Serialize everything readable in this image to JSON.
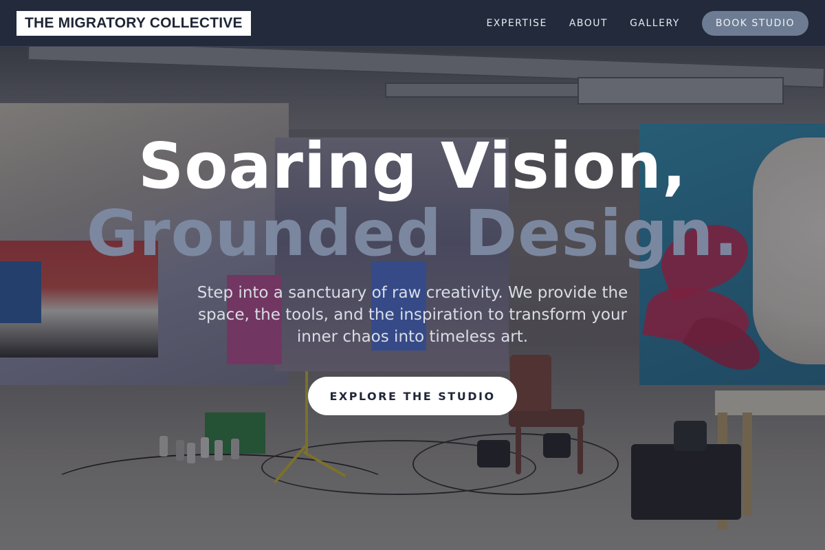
{
  "header": {
    "brand": "THE MIGRATORY COLLECTIVE",
    "nav": [
      {
        "label": "EXPERTISE"
      },
      {
        "label": "ABOUT"
      },
      {
        "label": "GALLERY"
      }
    ],
    "cta_label": "BOOK STUDIO"
  },
  "hero": {
    "headline_line1": "Soaring Vision,",
    "headline_line2": "Grounded Design.",
    "subtext": "Step into a sanctuary of raw creativity. We provide the space, the tools, and the inspiration to transform your inner chaos into timeless art.",
    "cta_label": "EXPLORE THE STUDIO"
  },
  "colors": {
    "header_bg": "#222a3c",
    "accent_muted": "#7e8ba3",
    "book_button_bg": "#6d7c93",
    "cta_bg": "#ffffff",
    "cta_text": "#1f2638"
  }
}
